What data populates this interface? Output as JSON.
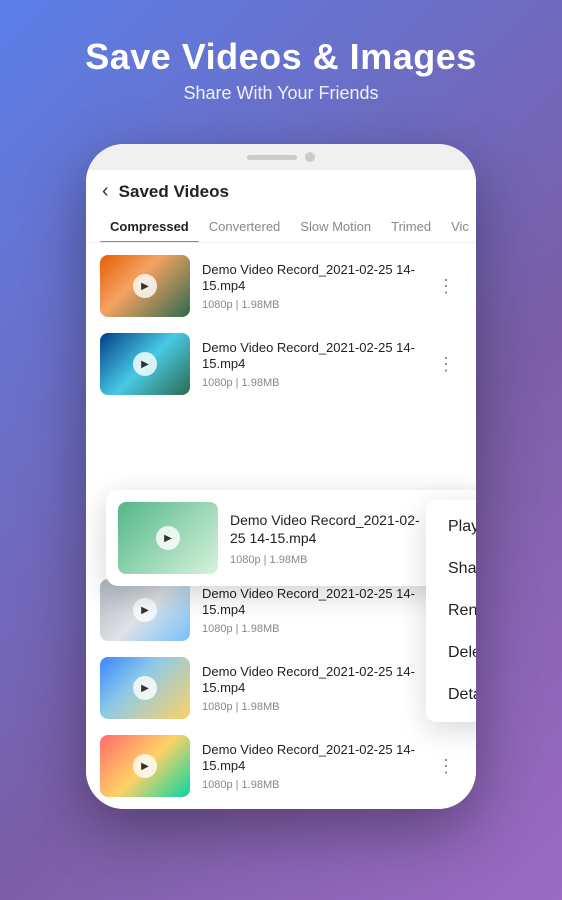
{
  "header": {
    "title": "Save Videos & Images",
    "subtitle": "Share With Your Friends"
  },
  "phone": {
    "back_label": "Saved Videos",
    "tabs": [
      {
        "label": "Compressed",
        "active": true
      },
      {
        "label": "Convertered",
        "active": false
      },
      {
        "label": "Slow Motion",
        "active": false
      },
      {
        "label": "Trimed",
        "active": false
      },
      {
        "label": "Vic",
        "active": false
      }
    ],
    "videos": [
      {
        "name": "Demo Video Record_2021-02-25 14-15.mp4",
        "meta": "1080p | 1.98MB",
        "thumb": "autumn"
      },
      {
        "name": "Demo Video Record_2021-02-25 14-15.mp4",
        "meta": "1080p | 1.98MB",
        "thumb": "waterfall"
      },
      {
        "name": "Demo Video Record_2021-02-25 14-15.mp4",
        "meta": "1080p | 1.98MB",
        "thumb": "field"
      },
      {
        "name": "Demo Video Record_2021-02-25 14-15.mp4",
        "meta": "1080p | 1.98MB",
        "thumb": "snow"
      },
      {
        "name": "Demo Video Record_2021-02-25 14-15.mp4",
        "meta": "1080p | 1.98MB",
        "thumb": "flowers"
      },
      {
        "name": "Demo Video Record_2021-02-25 14-15.mp4",
        "meta": "1080p | 1.98MB",
        "thumb": "beach"
      }
    ],
    "floating_video": {
      "name": "Demo Video Record_2021-02-25 14-15.mp4",
      "meta": "1080p | 1.98MB",
      "thumb": "field"
    },
    "context_menu": {
      "items": [
        "Play",
        "Share",
        "Rename",
        "Delete",
        "Details"
      ]
    }
  }
}
